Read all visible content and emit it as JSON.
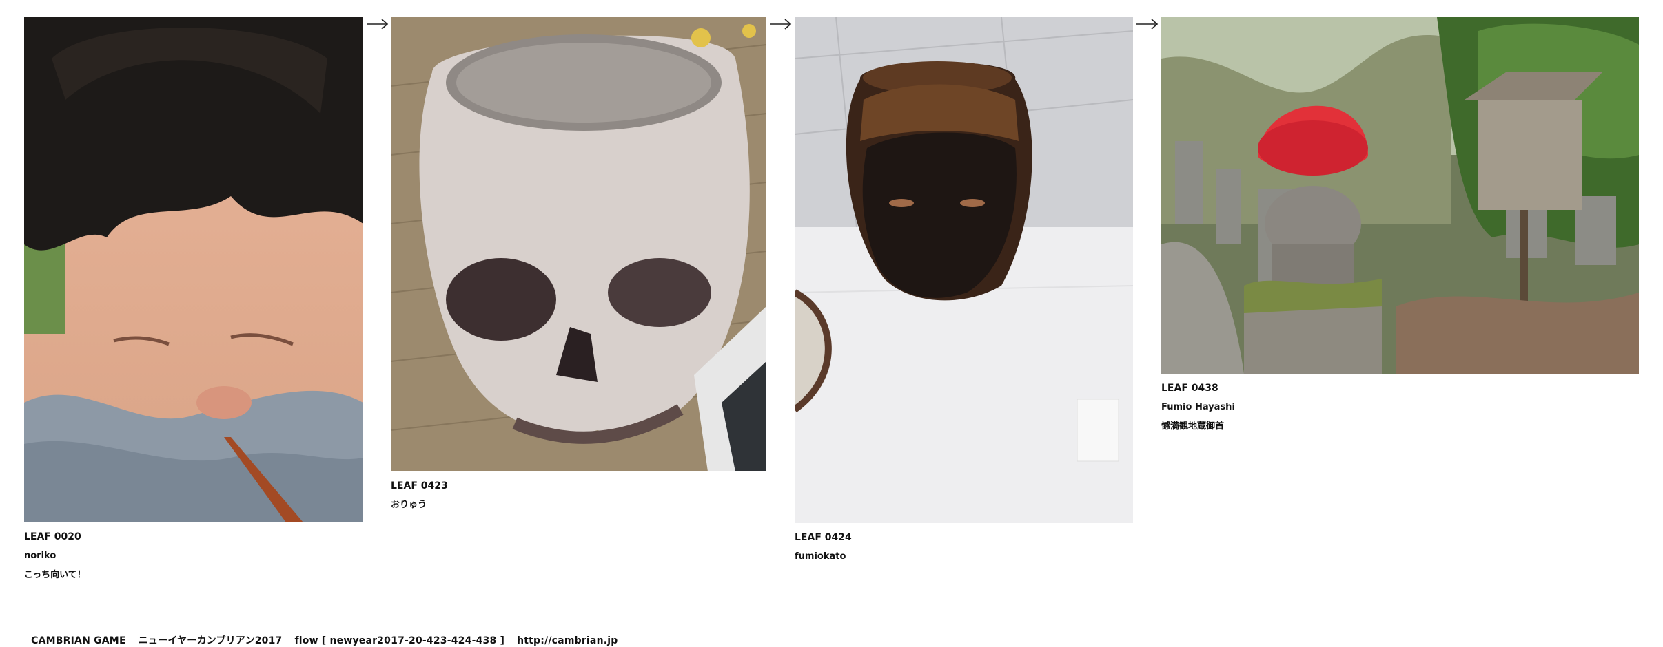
{
  "flow": {
    "arrows": [
      "→",
      "→",
      "→"
    ],
    "leaves": [
      {
        "id": "LEAF 0020",
        "author": "noriko",
        "title": "こっち向いて！",
        "image": "baby-photo"
      },
      {
        "id": "LEAF 0423",
        "author": "おりゅう",
        "image": "ceramic-skull-photo"
      },
      {
        "id": "LEAF 0424",
        "author": "fumiokato",
        "image": "face-pot-photo"
      },
      {
        "id": "LEAF 0438",
        "author": "Fumio Hayashi",
        "title": "憾満観地蔵御首",
        "image": "jizo-statue-photo"
      }
    ]
  },
  "footer": {
    "brand": "CAMBRIAN GAME",
    "event": "ニューイヤーカンブリアン2017",
    "flow_label": "flow [ newyear2017-20-423-424-438 ]",
    "url": "http://cambrian.jp"
  },
  "colors": {
    "text": "#111111",
    "background": "#ffffff",
    "jizo_cap": "#e23139"
  }
}
